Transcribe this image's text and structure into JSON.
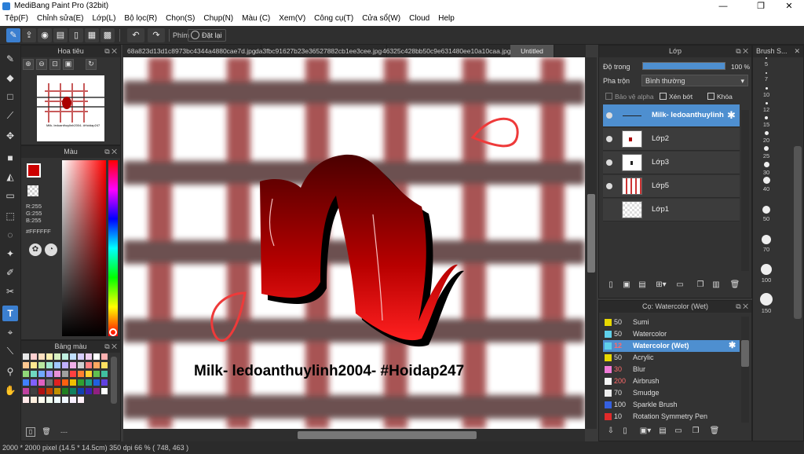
{
  "window": {
    "title": "MediBang Paint Pro (32bit)",
    "minimize": "—",
    "restore": "❐",
    "close": "✕"
  },
  "menu": [
    "Tệp(F)",
    "Chỉnh sửa(E)",
    "Lớp(L)",
    "Bộ lọc(R)",
    "Chọn(S)",
    "Chụp(N)",
    "Màu (C)",
    "Xem(V)",
    "Công cụ(T)",
    "Cửa sổ(W)",
    "Cloud",
    "Help"
  ],
  "toolbar": {
    "pen_label": "Phím",
    "reset_label": "Đặt lại"
  },
  "navigator": {
    "title": "Hoa tiêu"
  },
  "color": {
    "title": "Màu",
    "r": "R:255",
    "g": "G:255",
    "b": "B:255",
    "hex": "#FFFFFF",
    "primary": "#cc0000"
  },
  "palette": {
    "title": "Bảng màu",
    "footer": "---"
  },
  "tabs": [
    "68a823d13d1c8973bc4344a4880cae7d.jpg",
    "da3fbc91627b23e36527882cb1ee3cee.jpg",
    "46325c428bb50c9e631480ee10a10caa.jpg",
    "Untitled"
  ],
  "canvas": {
    "caption": "Milk- ledoanthuylinh2004- #Hoidap247"
  },
  "layer": {
    "title": "Lớp",
    "opacity_label": "Độ trong",
    "opacity_value": "100 %",
    "blend_label": "Pha trộn",
    "blend_value": "Bình thường",
    "protect_alpha": "Bảo vệ alpha",
    "clip": "Xén bớt",
    "lock": "Khóa",
    "layers": [
      {
        "name": "Milk- ledoanthuylinh"
      },
      {
        "name": "Lớp2"
      },
      {
        "name": "Lớp3"
      },
      {
        "name": "Lớp5"
      },
      {
        "name": "Lớp1"
      }
    ]
  },
  "brush": {
    "title": "Cọ: Watercolor (Wet)",
    "items": [
      {
        "size": "50",
        "name": "Sumi",
        "color": "#e8d800"
      },
      {
        "size": "50",
        "name": "Watercolor",
        "color": "#5fd0ea"
      },
      {
        "size": "12",
        "name": "Watercolor (Wet)",
        "color": "#5fd0ea"
      },
      {
        "size": "50",
        "name": "Acrylic",
        "color": "#e8d800"
      },
      {
        "size": "30",
        "name": "Blur",
        "color": "#f07bd8"
      },
      {
        "size": "200",
        "name": "Airbrush",
        "color": "#f5f5f5"
      },
      {
        "size": "70",
        "name": "Smudge",
        "color": "#eeeeee"
      },
      {
        "size": "100",
        "name": "Sparkle Brush",
        "color": "#3560e0"
      },
      {
        "size": "10",
        "name": "Rotation Symmetry Pen",
        "color": "#e02a2a"
      }
    ]
  },
  "brush_size": {
    "title": "Brush S...",
    "sizes": [
      "5",
      "7",
      "10",
      "12",
      "15",
      "20",
      "25",
      "30",
      "40",
      "50",
      "70",
      "100",
      "150"
    ]
  },
  "status": {
    "text": "2000 * 2000 pixel  (14.5 * 14.5cm)  350 dpi  66 %  ( 748, 463 )"
  }
}
